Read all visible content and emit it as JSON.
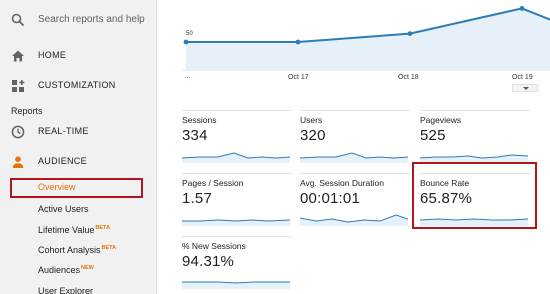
{
  "sidebar": {
    "search_placeholder": "Search reports and help",
    "nav": {
      "home": {
        "label": "HOME",
        "icon": "home-icon"
      },
      "customization": {
        "label": "CUSTOMIZATION",
        "icon": "customization-icon"
      },
      "reports_title": "Reports",
      "realtime": {
        "label": "REAL-TIME",
        "icon": "clock-icon"
      },
      "audience": {
        "label": "AUDIENCE",
        "icon": "person-icon"
      }
    },
    "audience_items": {
      "overview": "Overview",
      "active_users": "Active Users",
      "lifetime_value": "Lifetime Value",
      "lifetime_value_badge": "BETA",
      "cohort_analysis": "Cohort Analysis",
      "cohort_analysis_badge": "BETA",
      "audiences": "Audiences",
      "audiences_badge": "NEW",
      "user_explorer": "User Explorer"
    }
  },
  "colors": {
    "accent_orange": "#e8710a",
    "highlight_red": "#b0171c",
    "chart_blue": "#2f7cb5",
    "chart_fill": "#e6f0f8"
  },
  "chart_data": {
    "type": "line",
    "x": [
      "…",
      "Oct 17",
      "Oct 18",
      "Oct 19"
    ],
    "series": [
      {
        "values": [
          50,
          50,
          53,
          62,
          58
        ]
      }
    ],
    "y_tick": "50",
    "ylim": [
      40,
      65
    ]
  },
  "metrics": {
    "sessions": {
      "label": "Sessions",
      "value": "334"
    },
    "users": {
      "label": "Users",
      "value": "320"
    },
    "pageviews": {
      "label": "Pageviews",
      "value": "525"
    },
    "pages_per_session": {
      "label": "Pages / Session",
      "value": "1.57"
    },
    "avg_session_duration": {
      "label": "Avg. Session Duration",
      "value": "00:01:01"
    },
    "bounce_rate": {
      "label": "Bounce Rate",
      "value": "65.87%"
    },
    "new_sessions": {
      "label": "% New Sessions",
      "value": "94.31%"
    }
  }
}
